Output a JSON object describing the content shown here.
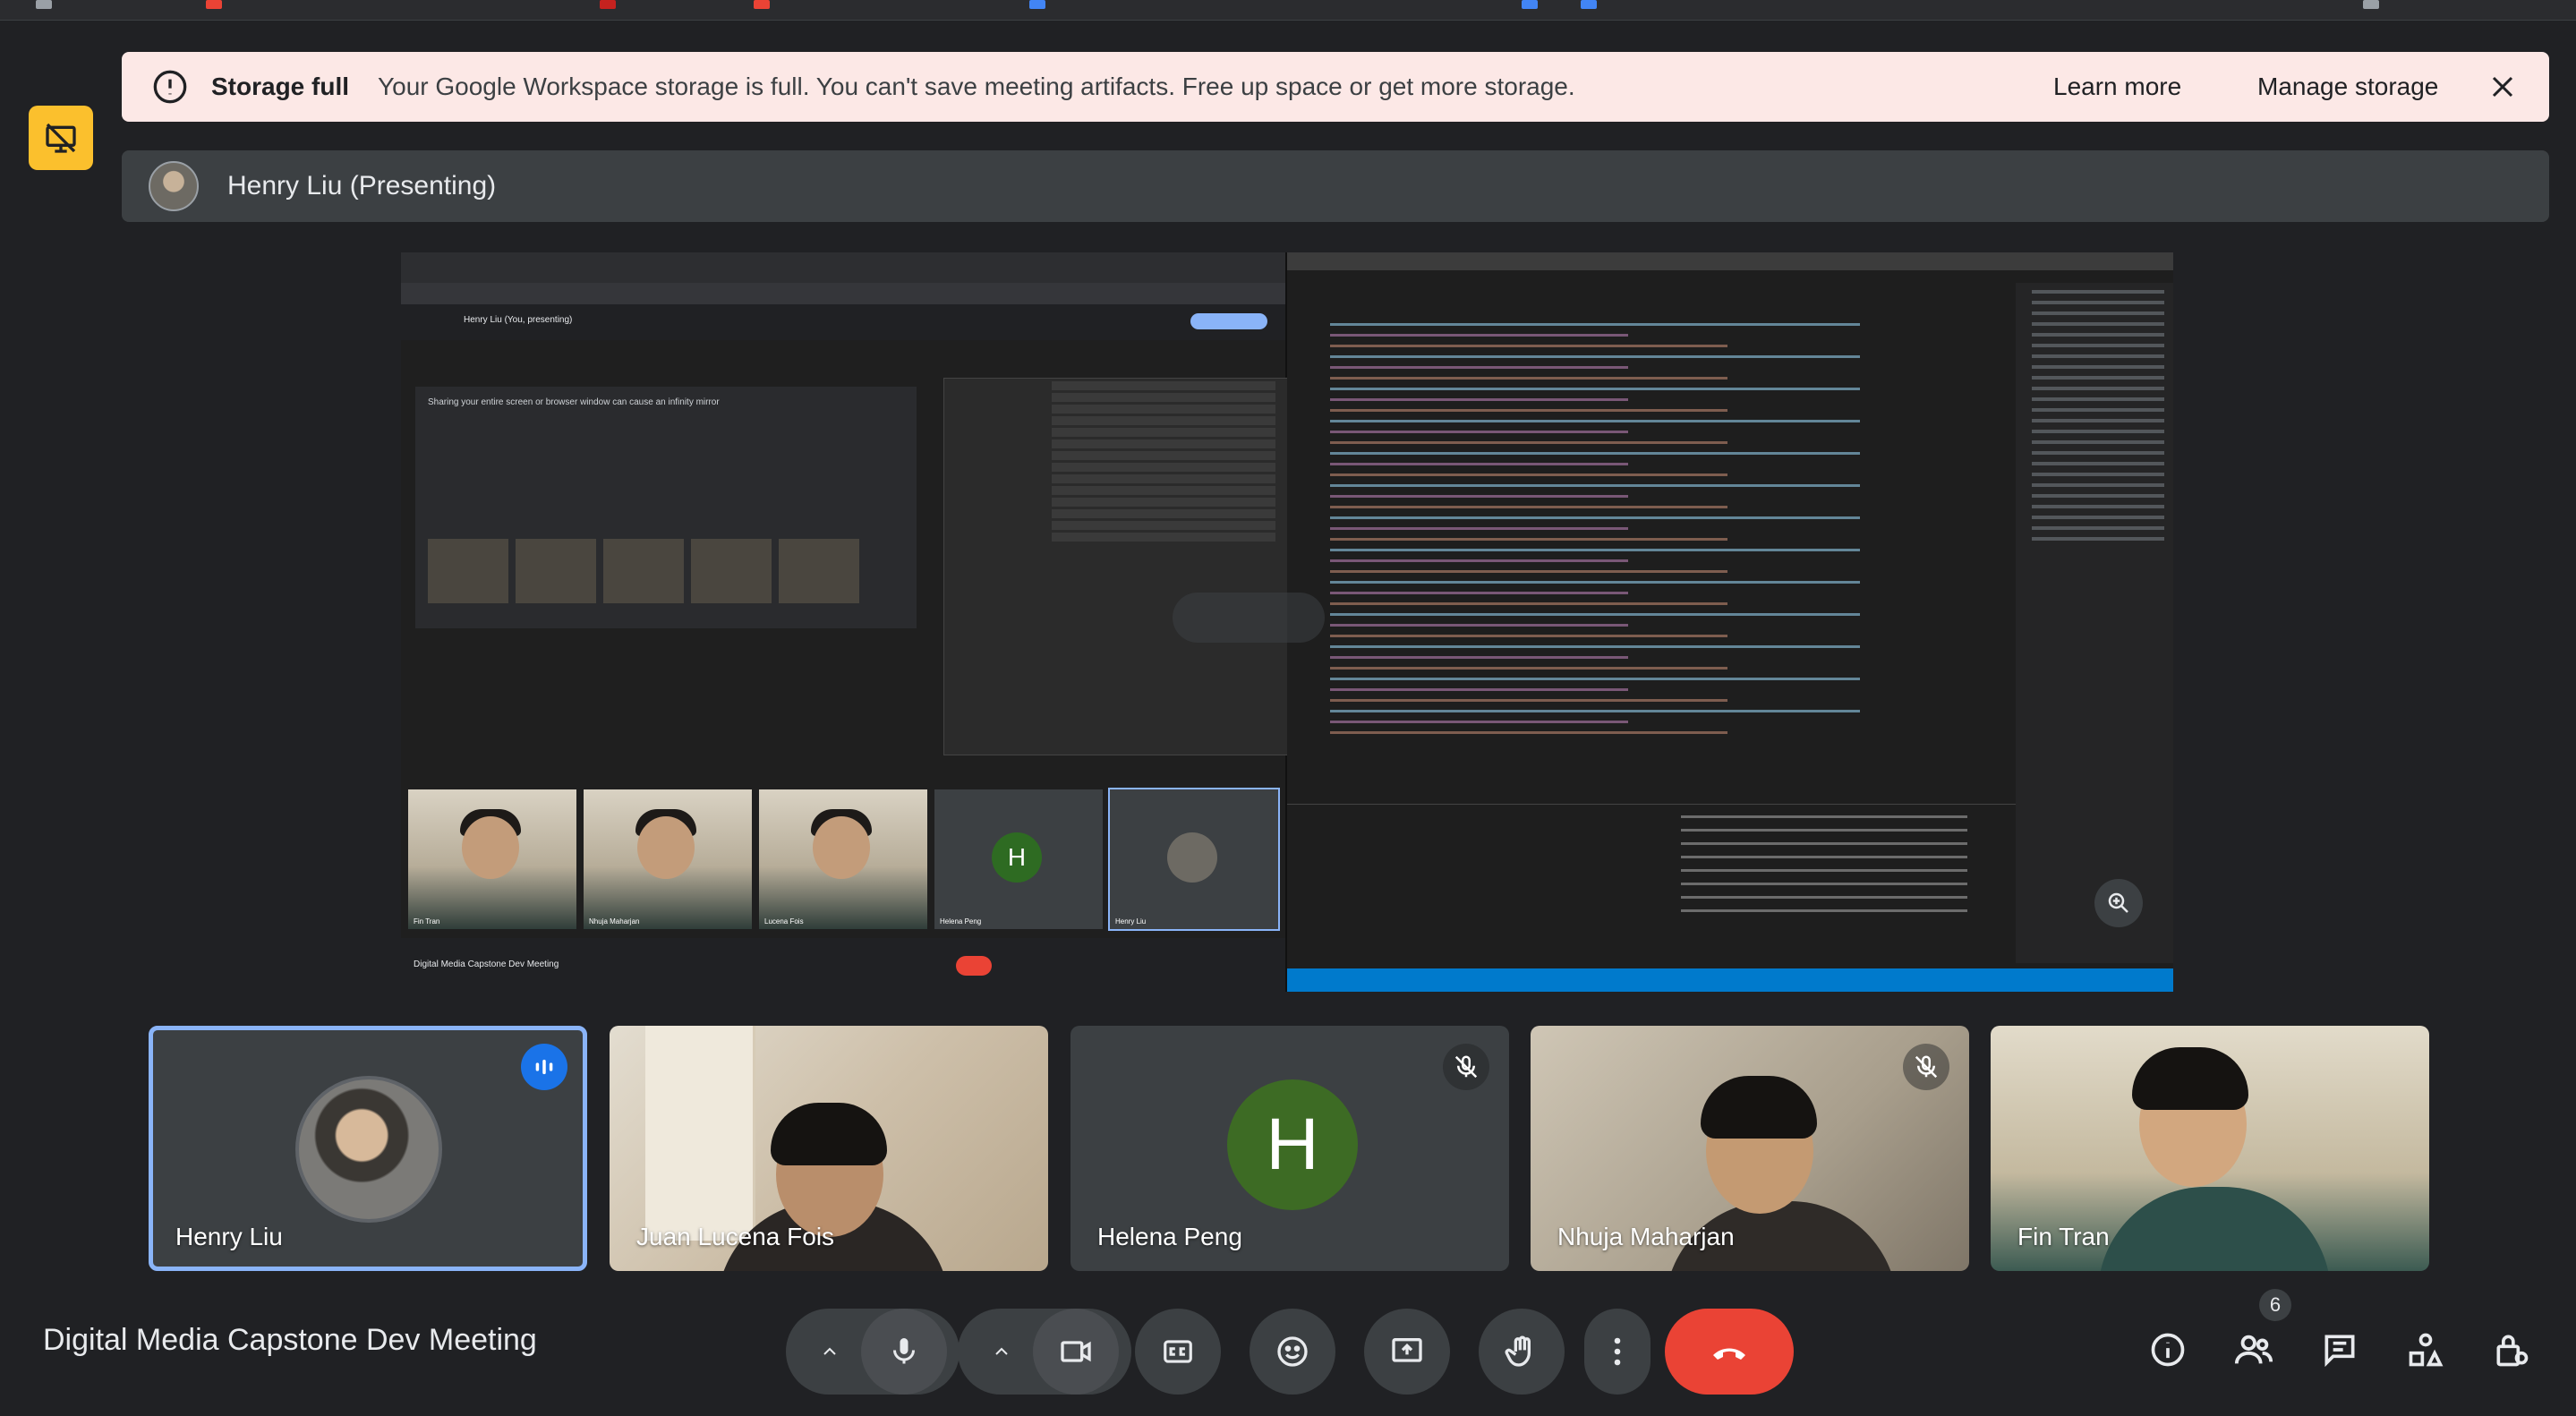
{
  "banner": {
    "title": "Storage full",
    "message": "Your Google Workspace storage is full. You can't save meeting artifacts. Free up space or get more storage.",
    "learn_more": "Learn more",
    "manage_storage": "Manage storage"
  },
  "presenter": {
    "label": "Henry Liu (Presenting)"
  },
  "shared_screen": {
    "meet_bar_text": "Henry Liu (You, presenting)",
    "warning_text": "Sharing your entire screen or browser window can cause an infinity mirror",
    "thumb_names": [
      "Fin Tran",
      "Nhuja Maharjan",
      "Lucena Fois",
      "Helena Peng",
      "Henry Liu"
    ],
    "thumb_initial": "H",
    "meeting_title": "Digital Media Capstone Dev Meeting"
  },
  "participants": [
    {
      "name": "Henry Liu",
      "state": "speaking"
    },
    {
      "name": "Juan Lucena Fois",
      "state": "camera"
    },
    {
      "name": "Helena Peng",
      "initial": "H",
      "state": "muted"
    },
    {
      "name": "Nhuja Maharjan",
      "state": "muted"
    },
    {
      "name": "Fin Tran",
      "state": "camera"
    }
  ],
  "bottom": {
    "meeting_name": "Digital Media Capstone Dev Meeting",
    "people_count": "6"
  },
  "colors": {
    "background": "#202124",
    "banner_bg": "#fce8e6",
    "accent": "#8ab4f8",
    "speaking": "#1a73e8",
    "end_call": "#ea4335",
    "helena_avatar": "#3d6b24",
    "noscreen_icon": "#fbc02d"
  },
  "icons": [
    "no-screen-icon",
    "warning-icon",
    "close-icon",
    "zoom-in-icon",
    "speaking-icon",
    "mic-off-icon",
    "chevron-up-icon",
    "mic-icon",
    "camera-icon",
    "captions-icon",
    "emoji-icon",
    "present-icon",
    "raise-hand-icon",
    "more-icon",
    "end-call-icon",
    "info-icon",
    "people-icon",
    "chat-icon",
    "activities-icon",
    "host-controls-icon"
  ]
}
